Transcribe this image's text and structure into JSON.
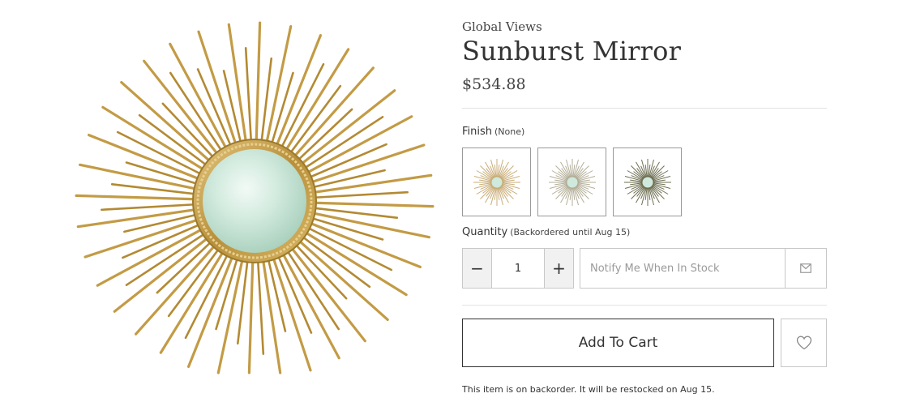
{
  "product": {
    "brand": "Global Views",
    "title": "Sunburst Mirror",
    "price": "$534.88",
    "image_icon": "sunburst-mirror-image"
  },
  "finish": {
    "label": "Finish",
    "selected": "(None)",
    "swatches": [
      {
        "name": "light-gold",
        "color": "#c9ad78"
      },
      {
        "name": "silver-gold",
        "color": "#b3ae98"
      },
      {
        "name": "dark-bronze",
        "color": "#6f6f52"
      }
    ]
  },
  "quantity": {
    "label": "Quantity",
    "status": "(Backordered until Aug 15)",
    "minus": "−",
    "value": "1",
    "plus": "+"
  },
  "notify": {
    "placeholder": "Notify Me When In Stock",
    "button_icon": "envelope-icon"
  },
  "cart": {
    "add_label": "Add To Cart",
    "wishlist_icon": "heart-icon"
  },
  "note": "This item is on backorder. It will be restocked on Aug 15.",
  "colors": {
    "gold": "#c39b45",
    "mirror": "#cfe9dc",
    "border": "#c8c8c8"
  }
}
